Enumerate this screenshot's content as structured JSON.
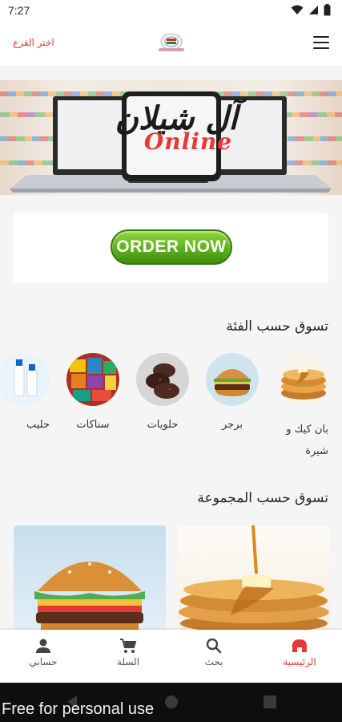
{
  "status_bar": {
    "time": "7:27",
    "icons": [
      "wifi-icon",
      "signal-icon",
      "battery-icon"
    ]
  },
  "app_bar": {
    "branch_link": "اختر الفرع",
    "logo": "store-logo",
    "menu_icon": "menu-icon"
  },
  "banner": {
    "brand_script": "آل شيلان",
    "brand_online": "Online"
  },
  "order": {
    "button_label": "ORDER NOW"
  },
  "categories_section": {
    "title": "تسوق حسب الفئة",
    "items": [
      {
        "label": "بان كيك و شيرة",
        "icon": "pancake-image"
      },
      {
        "label": "برجر",
        "icon": "burger-image"
      },
      {
        "label": "حلويات",
        "icon": "cookies-image"
      },
      {
        "label": "سناكات",
        "icon": "snacks-image"
      },
      {
        "label": "حليب",
        "icon": "milk-image"
      }
    ]
  },
  "groups_section": {
    "title": "تسوق حسب المجموعة",
    "cards": [
      {
        "icon": "pancake-photo"
      },
      {
        "icon": "burger-photo"
      }
    ]
  },
  "bottom_nav": {
    "items": [
      {
        "label": "الرئيسية",
        "icon": "home-icon",
        "active": true
      },
      {
        "label": "بحث",
        "icon": "search-icon",
        "active": false
      },
      {
        "label": "السلة",
        "icon": "cart-icon",
        "active": false
      },
      {
        "label": "حسابي",
        "icon": "person-icon",
        "active": false
      }
    ]
  },
  "watermark": "Free for personal use",
  "colors": {
    "accent": "#e53935",
    "order_green": "#5fb21e",
    "nav_bar": "#0e0e0e"
  }
}
